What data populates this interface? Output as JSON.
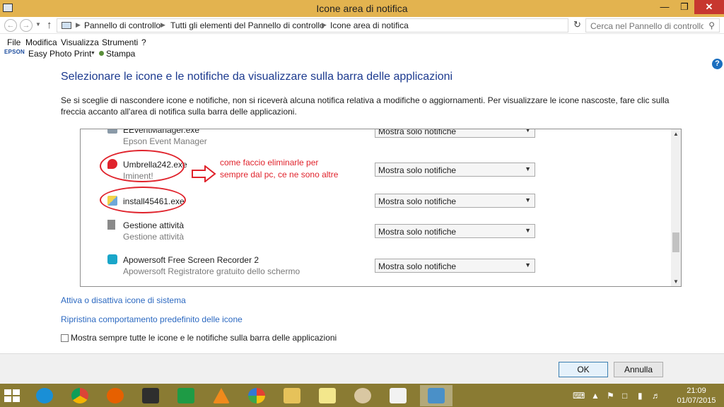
{
  "window": {
    "title": "Icone area di notifica"
  },
  "address": {
    "crumbs": [
      "Pannello di controllo",
      "Tutti gli elementi del Pannello di controllo",
      "Icone area di notifica"
    ],
    "search_placeholder": "Cerca nel Pannello di controllo"
  },
  "menu": [
    "File",
    "Modifica",
    "Visualizza",
    "Strumenti",
    "?"
  ],
  "favorites": {
    "epson": "EPSON",
    "photo_print": "Easy Photo Print",
    "stampa": "Stampa"
  },
  "heading": "Selezionare le icone e le notifiche da visualizzare sulla barra delle applicazioni",
  "description": "Se si sceglie di nascondere icone e notifiche, non si riceverà alcuna notifica relativa a modifiche o aggiornamenti. Per visualizzare le icone nascoste, fare clic sulla freccia accanto all'area di notifica sulla barra delle applicazioni.",
  "list": {
    "rows": [
      {
        "name": "EEventManager.exe",
        "sub": "Epson Event Manager",
        "behavior": "Mostra solo notifiche",
        "icon": "epson-icon"
      },
      {
        "name": "Umbrella242.exe",
        "sub": "Iminent!",
        "behavior": "Mostra solo notifiche",
        "icon": "red-bubble-icon"
      },
      {
        "name": "install45461.exe",
        "sub": "",
        "behavior": "Mostra solo notifiche",
        "icon": "installer-icon"
      },
      {
        "name": "Gestione attività",
        "sub": "Gestione attività",
        "behavior": "Mostra solo notifiche",
        "icon": "task-manager-icon"
      },
      {
        "name": "Apowersoft Free Screen Recorder 2",
        "sub": "Apowersoft Registratore gratuito dello schermo",
        "behavior": "Mostra solo notifiche",
        "icon": "recorder-icon"
      }
    ]
  },
  "annotation": {
    "text": "come faccio eliminarle per\nsempre dal pc, ce ne sono altre",
    "color": "#e0232c"
  },
  "links": {
    "system_icons": "Attiva o disattiva icone di sistema",
    "restore_default": "Ripristina comportamento predefinito delle icone"
  },
  "checkbox": {
    "label": "Mostra sempre tutte le icone e le notifiche sulla barra delle applicazioni",
    "checked": false
  },
  "buttons": {
    "ok": "OK",
    "cancel": "Annulla"
  },
  "taskbar": {
    "apps": [
      "internet-explorer-icon",
      "chrome-icon",
      "firefox-icon",
      "app-icon",
      "store-icon",
      "vlc-icon",
      "picasa-icon",
      "folder-icon",
      "sticky-notes-icon",
      "paint-icon",
      "notepad-icon",
      "control-panel-icon"
    ],
    "time": "21:09",
    "date": "01/07/2015"
  },
  "colors": {
    "titlebar": "#e3b34f",
    "taskbar": "#8a7b33",
    "link": "#2c69c1",
    "heading": "#1c3a8f"
  }
}
